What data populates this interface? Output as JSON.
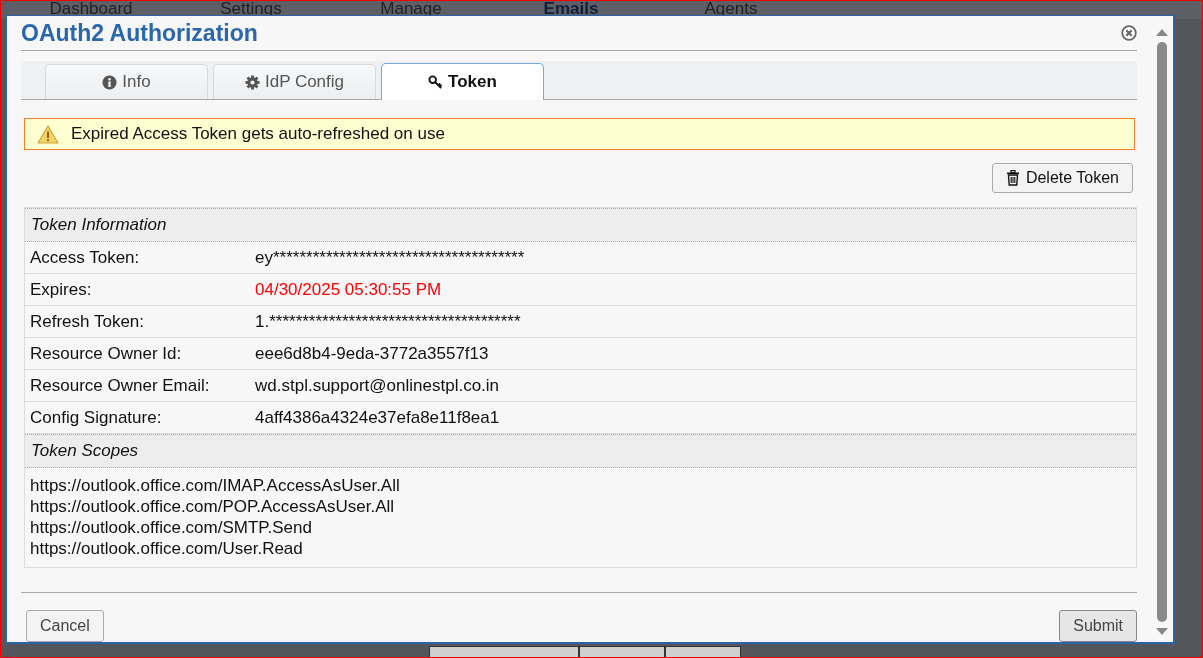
{
  "background_nav": [
    "Dashboard",
    "Settings",
    "Manage",
    "Emails",
    "Agents"
  ],
  "dialog": {
    "title": "OAuth2 Authorization",
    "tabs": [
      {
        "label": "Info",
        "kind": "info",
        "selected": false
      },
      {
        "label": "IdP Config",
        "kind": "config",
        "selected": false
      },
      {
        "label": "Token",
        "kind": "token",
        "selected": true
      }
    ],
    "alert": "Expired Access Token gets auto-refreshed on use",
    "delete_button": "Delete Token",
    "token_information": {
      "heading": "Token Information",
      "rows": [
        {
          "label": "Access Token:",
          "value": "ey**************************************",
          "kind": "normal"
        },
        {
          "label": "Expires:",
          "value": "04/30/2025 05:30:55 PM",
          "kind": "expired"
        },
        {
          "label": "Refresh Token:",
          "value": "1.**************************************",
          "kind": "normal"
        },
        {
          "label": "Resource Owner Id:",
          "value": "eee6d8b4-9eda-3772a3557f13",
          "kind": "redacted"
        },
        {
          "label": "Resource Owner Email:",
          "value": "wd.stpl.support@onlinestpl.co.in",
          "kind": "normal"
        },
        {
          "label": "Config Signature:",
          "value": "4aff4386a4324e37efa8e11f8ea1",
          "kind": "redacted"
        }
      ]
    },
    "token_scopes": {
      "heading": "Token Scopes",
      "items": [
        "https://outlook.office.com/IMAP.AccessAsUser.All",
        "https://outlook.office.com/POP.AccessAsUser.All",
        "https://outlook.office.com/SMTP.Send",
        "https://outlook.office.com/User.Read"
      ]
    },
    "buttons": {
      "cancel": "Cancel",
      "submit": "Submit"
    }
  }
}
